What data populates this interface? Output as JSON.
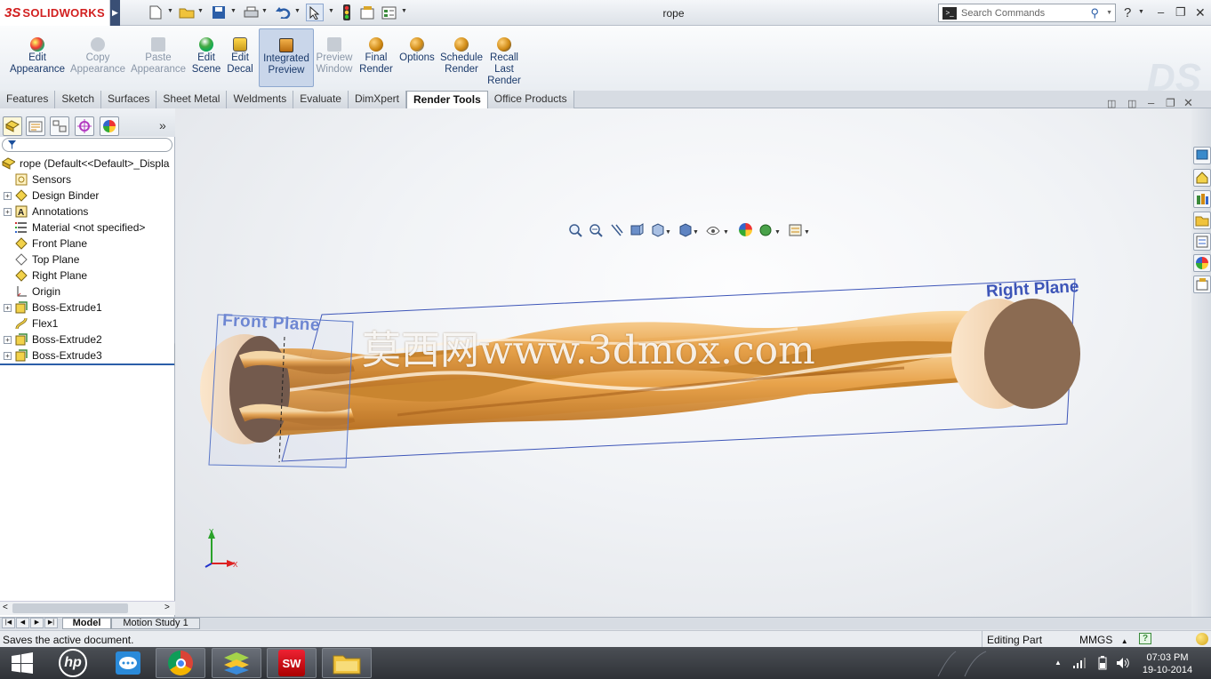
{
  "app": {
    "brand_prefix": "3S",
    "brand": "SOLIDWORKS",
    "document_title": "rope"
  },
  "search": {
    "placeholder": "Search Commands"
  },
  "ribbon": [
    {
      "label_line1": "Edit",
      "label_line2": "Appearance",
      "enabled": true,
      "icon": "appearance-icon",
      "color": "#d9322b"
    },
    {
      "label_line1": "Copy",
      "label_line2": "Appearance",
      "enabled": false,
      "icon": "copy-appearance-icon",
      "color": "#9aa5b3"
    },
    {
      "label_line1": "Paste",
      "label_line2": "Appearance",
      "enabled": false,
      "icon": "paste-appearance-icon",
      "color": "#9aa5b3"
    },
    {
      "label_line1": "Edit",
      "label_line2": "Scene",
      "enabled": true,
      "icon": "scene-icon",
      "color": "#3b9c3b"
    },
    {
      "label_line1": "Edit",
      "label_line2": "Decal",
      "enabled": true,
      "icon": "decal-icon",
      "color": "#caa31e"
    },
    {
      "label_line1": "Integrated",
      "label_line2": "Preview",
      "enabled": true,
      "icon": "integrated-preview-icon",
      "color": "#c77b12"
    },
    {
      "label_line1": "Preview",
      "label_line2": "Window",
      "enabled": false,
      "icon": "preview-window-icon",
      "color": "#9aa5b3"
    },
    {
      "label_line1": "Final",
      "label_line2": "Render",
      "enabled": true,
      "icon": "final-render-icon",
      "color": "#d08a14"
    },
    {
      "label_line1": "Options",
      "label_line2": "",
      "enabled": true,
      "icon": "options-icon",
      "color": "#d08a14"
    },
    {
      "label_line1": "Schedule",
      "label_line2": "Render",
      "enabled": true,
      "icon": "schedule-render-icon",
      "color": "#d08a14"
    },
    {
      "label_line1": "Recall",
      "label_line2": "Last",
      "label_line3": "Render",
      "enabled": true,
      "icon": "recall-render-icon",
      "color": "#d08a14"
    }
  ],
  "tabs": [
    "Features",
    "Sketch",
    "Surfaces",
    "Sheet Metal",
    "Weldments",
    "Evaluate",
    "DimXpert",
    "Render Tools",
    "Office Products"
  ],
  "active_tab": "Render Tools",
  "tree": {
    "root": "rope  (Default<<Default>_Displa",
    "items": [
      {
        "label": "Sensors",
        "icon": "sensors-icon",
        "expandable": false
      },
      {
        "label": "Design Binder",
        "icon": "design-binder-icon",
        "expandable": true
      },
      {
        "label": "Annotations",
        "icon": "annotations-icon",
        "expandable": true
      },
      {
        "label": "Material <not specified>",
        "icon": "material-icon",
        "expandable": false
      },
      {
        "label": "Front Plane",
        "icon": "plane-icon",
        "expandable": false
      },
      {
        "label": "Top Plane",
        "icon": "plane-icon",
        "expandable": false
      },
      {
        "label": "Right Plane",
        "icon": "plane-icon",
        "expandable": false
      },
      {
        "label": "Origin",
        "icon": "origin-icon",
        "expandable": false
      },
      {
        "label": "Boss-Extrude1",
        "icon": "extrude-icon",
        "expandable": true
      },
      {
        "label": "Flex1",
        "icon": "flex-icon",
        "expandable": false
      },
      {
        "label": "Boss-Extrude2",
        "icon": "extrude-icon",
        "expandable": true
      },
      {
        "label": "Boss-Extrude3",
        "icon": "extrude-icon",
        "expandable": true
      }
    ]
  },
  "viewport": {
    "front_plane_label": "Front Plane",
    "right_plane_label": "Right Plane",
    "watermark": "莫西网www.3dmox.com",
    "triad": {
      "y": "Y",
      "x": "X"
    }
  },
  "bottom_tabs": [
    "Model",
    "Motion Study 1"
  ],
  "active_bottom_tab": "Model",
  "status": {
    "message": "Saves the active document.",
    "mode": "Editing Part",
    "units": "MMGS"
  },
  "taskbar": {
    "time": "07:03 PM",
    "date": "19-10-2014",
    "hp": "hp",
    "sw": "SW"
  },
  "colors": {
    "rope": "#e5a24a",
    "plane": "#3d55b8",
    "accent": "#1b3a6b"
  }
}
